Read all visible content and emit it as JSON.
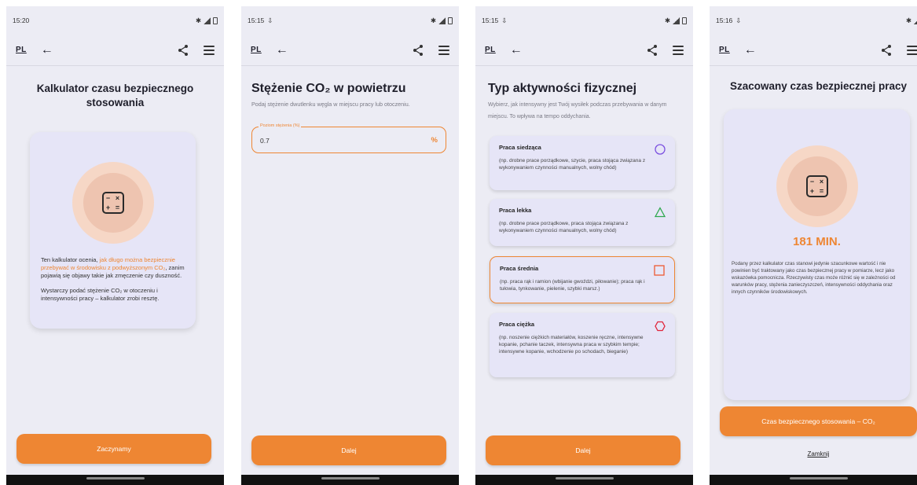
{
  "app": {
    "lang": "PL",
    "back_glyph": "←"
  },
  "screen1": {
    "time": "15:20",
    "title": "Kalkulator czasu bezpiecznego stosowania",
    "para1_a": "Ten kalkulator ocenia, ",
    "para1_b": "jak długo można bezpiecznie przebywać w środowisku z podwyższonym CO₂",
    "para1_c": ", zanim pojawią się objawy takie jak zmęczenie czy duszność.",
    "para2": "Wystarczy podać stężenie CO₂ w otoczeniu i intensywności pracy – kalkulator zrobi resztę.",
    "button": "Zaczynamy"
  },
  "screen2": {
    "time": "15:15",
    "title": "Stężenie CO₂ w powietrzu",
    "subtitle": "Podaj stężenie dwutlenku węgla w miejscu pracy lub otoczeniu.",
    "field_label": "Poziom stężenia (%)",
    "field_value": "0.7",
    "field_unit": "%",
    "button": "Dalej"
  },
  "screen3": {
    "time": "15:15",
    "title": "Typ aktywności fizycznej",
    "subtitle": "Wybierz, jak intensywny jest Twój wysiłek podczas przebywania w danym miejscu. To wpływa na tempo oddychania.",
    "activities": [
      {
        "name": "Praca siedząca",
        "desc": "(np. drobne prace porządkowe, szycie, praca stojąca związana z wykonywaniem czynności manualnych, wolny chód)",
        "icon": "circle-icon",
        "color": "#7b4fe0"
      },
      {
        "name": "Praca lekka",
        "desc": "(np. drobne prace porządkowe, praca stojąca związana z wykonywaniem czynności manualnych, wolny chód)",
        "icon": "triangle-icon",
        "color": "#2fa84f"
      },
      {
        "name": "Praca średnia",
        "desc": "(np. praca rąk i ramion (wbijanie gwoździ, piłowanie); praca rąk i tułowia, tynkowanie, pielenie, szybki marsz.)",
        "icon": "square-icon",
        "color": "#ee5a33"
      },
      {
        "name": "Praca ciężka",
        "desc": "(np. noszenie ciężkich materiałów, koszenie ręczne, intensywne kopanie, pchanie taczek, intensywna praca w szybkim tempie; intensywne kopanie, wchodzenie po schodach, bieganie)",
        "icon": "hexagon-icon",
        "color": "#e0243a"
      }
    ],
    "selected_index": 2,
    "button": "Dalej"
  },
  "screen4": {
    "time": "15:16",
    "title": "Szacowany czas bezpiecznej pracy",
    "result": "181 MIN.",
    "disclaimer": "Podany przez kalkulator czas stanowi jedynie szacunkowe wartość i nie powinien być traktowany jako czas bezpiecznej pracy w pomiarze, lecz jako wskazówka pomocnicza. Rzeczywisty czas może różnić się w zależności od warunków pracy, stężenia zanieczyszczeń, intensywności oddychania oraz innych czynników środowiskowych.",
    "button": "Czas bezpiecznego stosowania – CO₂",
    "close": "Zamknij"
  },
  "colors": {
    "accent": "#ee8633",
    "background": "#ececf4",
    "card": "#e6e5f7"
  }
}
